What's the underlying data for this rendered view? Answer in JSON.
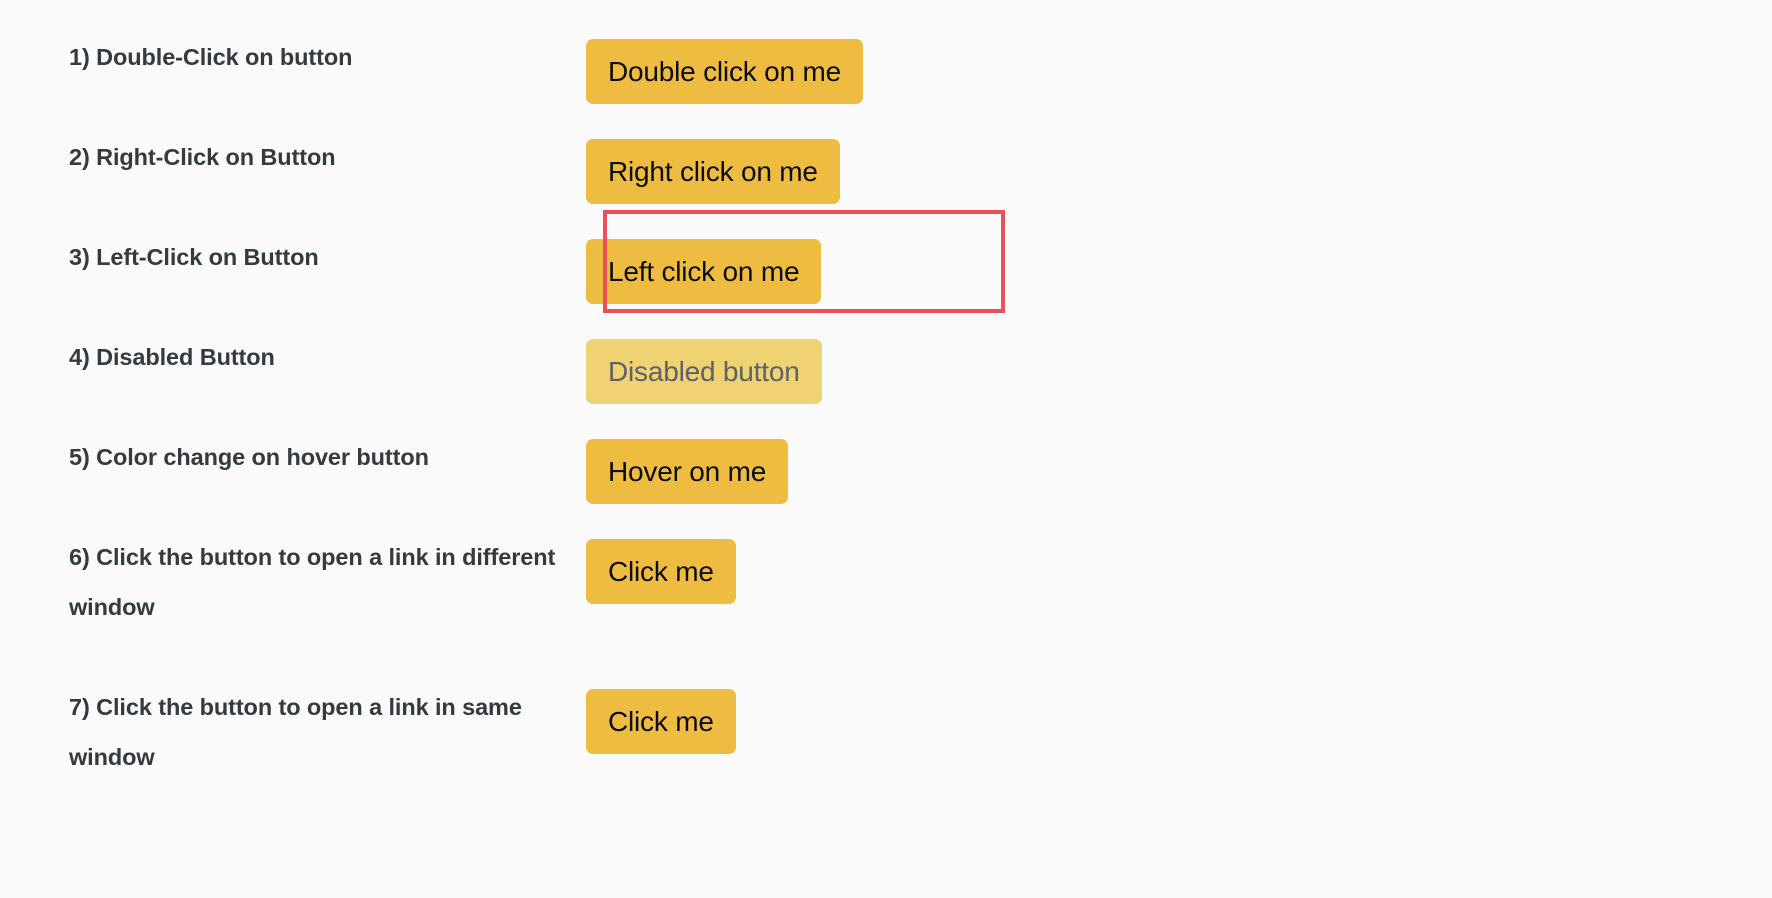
{
  "page": {
    "background_color": "#fafafa",
    "label_text_color": "#333a40",
    "button_color": "#efbc42",
    "button_text_color": "#0c0c0c",
    "disabled_button_color": "#efd271",
    "disabled_button_text_color": "#5e6166",
    "highlight_color": "#e9505a"
  },
  "exercises": [
    {
      "label": "1) Double-Click on button",
      "button_label": "Double click on me",
      "state": "enabled",
      "highlighted": false
    },
    {
      "label": "2) Right-Click on Button",
      "button_label": "Right click on me",
      "state": "enabled",
      "highlighted": false
    },
    {
      "label": "3) Left-Click on Button",
      "button_label": "Left click on me",
      "state": "enabled",
      "highlighted": true
    },
    {
      "label": "4) Disabled Button",
      "button_label": "Disabled button",
      "state": "disabled",
      "highlighted": false
    },
    {
      "label": "5) Color change on hover button",
      "button_label": "Hover on me",
      "state": "enabled",
      "highlighted": false
    },
    {
      "label": "6) Click the button to open a link in different window",
      "button_label": "Click me",
      "state": "enabled",
      "highlighted": false
    },
    {
      "label": "7) Click the button to open a link in same window",
      "button_label": "Click me",
      "state": "enabled",
      "highlighted": false
    }
  ]
}
